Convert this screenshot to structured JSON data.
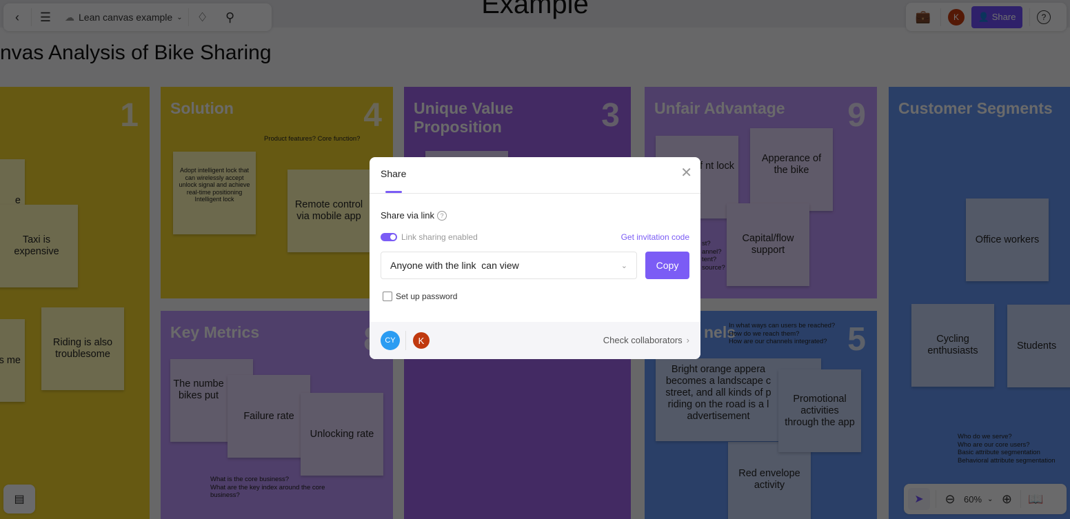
{
  "app": {
    "doc_title": "Example",
    "page_title": "nvas Analysis of Bike Sharing",
    "file_name": "Lean canvas example"
  },
  "toolbar_right": {
    "avatar": "K",
    "share_label": "Share"
  },
  "panels": {
    "problem": {
      "number": "1",
      "notes": [
        "e",
        "Taxi is expensive",
        "s me",
        "Riding is also troublesome"
      ]
    },
    "solution": {
      "title": "Solution",
      "number": "4",
      "hint": "Product features? Core function?",
      "notes": [
        "Adopt intelligent lock that can wirelessly accept unlock signal and achieve real-time positioning Intelligent lock",
        "Remote control via mobile app"
      ]
    },
    "key_metrics": {
      "title": "Key Metrics",
      "number": "8",
      "hint": "What is the core business?\nWhat are the key index around the core business?",
      "notes": [
        "The numbe bikes put",
        "Failure rate",
        "Unlocking rate"
      ]
    },
    "uvp": {
      "title": "Unique Value Proposition",
      "number": "3"
    },
    "unfair": {
      "title": "Unfair Advantage",
      "number": "9",
      "hint": "st?\nannel?\ntent?\nsource?",
      "notes": [
        "t of nt lock",
        "Apperance of the bike",
        "Capital/flow support"
      ]
    },
    "channels": {
      "title": "nels",
      "number": "5",
      "hint": "In what ways can users be reached?\nHow do we reach them?\nHow are our channels integrated?",
      "notes": [
        "Bright orange appera becomes a landscape c street, and all kinds of p riding on the road is a l advertisement",
        "Promotional activities through the app",
        "Red envelope activity"
      ]
    },
    "segments": {
      "title": "Customer Segments",
      "hint": "Who do we serve?\nWho are our core users?\nBasic attribute segmentation\nBehavioral attribute segmentation",
      "notes": [
        "Office workers",
        "Cycling enthusiasts",
        "Students"
      ]
    }
  },
  "zoom": {
    "level": "60%"
  },
  "share_modal": {
    "title": "Share",
    "section": "Share via link",
    "link_sharing_label": "Link sharing enabled",
    "link_sharing_enabled": true,
    "invitation_link": "Get invitation code",
    "permission_value": "Anyone with the link  can view",
    "copy_label": "Copy",
    "password_label": "Set up password",
    "password_checked": false,
    "collaborators": [
      {
        "initials": "CY",
        "color": "#2b9cf2"
      },
      {
        "initials": "K",
        "color": "#c0390e"
      }
    ],
    "check_collaborators": "Check collaborators"
  },
  "colors": {
    "accent": "#7b5cf5"
  }
}
